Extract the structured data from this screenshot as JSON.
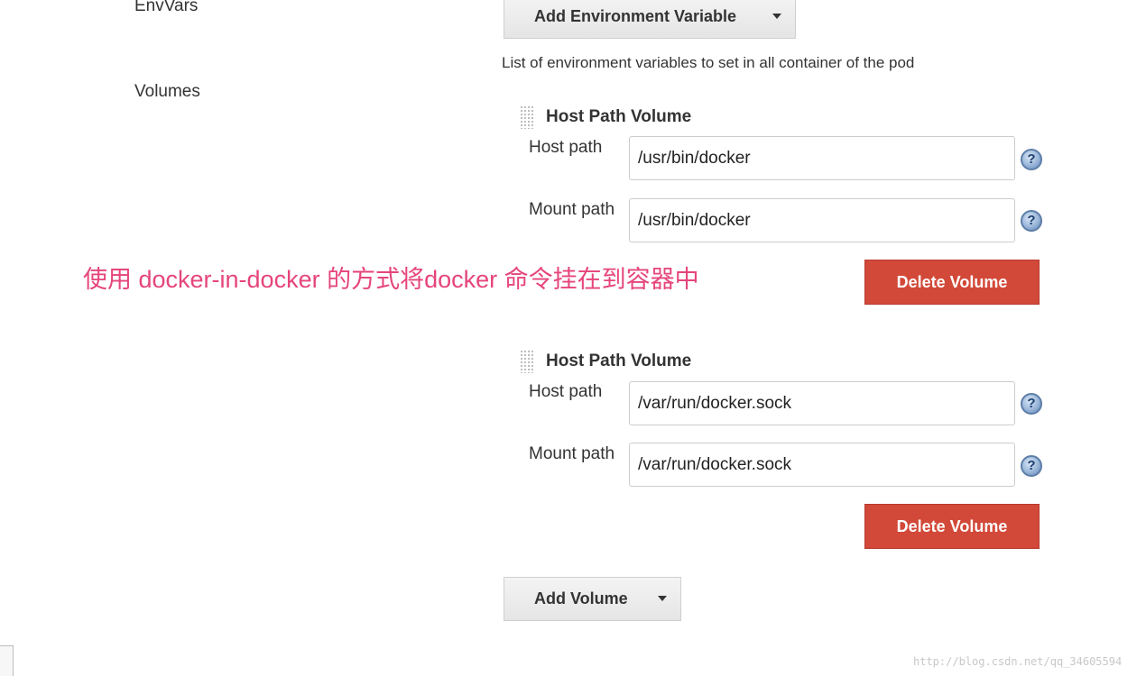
{
  "envvars": {
    "label": "EnvVars",
    "add_button_label": "Add Environment Variable",
    "description": "List of environment variables to set in all container of the pod"
  },
  "volumes": {
    "label": "Volumes",
    "items": [
      {
        "title": "Host Path Volume",
        "host_path_label": "Host path",
        "host_path_value": "/usr/bin/docker",
        "mount_path_label": "Mount path",
        "mount_path_value": "/usr/bin/docker",
        "delete_label": "Delete Volume"
      },
      {
        "title": "Host Path Volume",
        "host_path_label": "Host path",
        "host_path_value": "/var/run/docker.sock",
        "mount_path_label": "Mount path",
        "mount_path_value": "/var/run/docker.sock",
        "delete_label": "Delete Volume"
      }
    ],
    "add_button_label": "Add Volume"
  },
  "annotation": "使用 docker-in-docker 的方式将docker 命令挂在到容器中",
  "watermark": "http://blog.csdn.net/qq_34605594",
  "help_icon_glyph": "?",
  "colors": {
    "annotation": "#e6457a",
    "delete_button": "#d24939",
    "help_icon": "#5d7ea8"
  },
  "icons": [
    "grip-icon",
    "help-icon",
    "caret-down-icon"
  ]
}
